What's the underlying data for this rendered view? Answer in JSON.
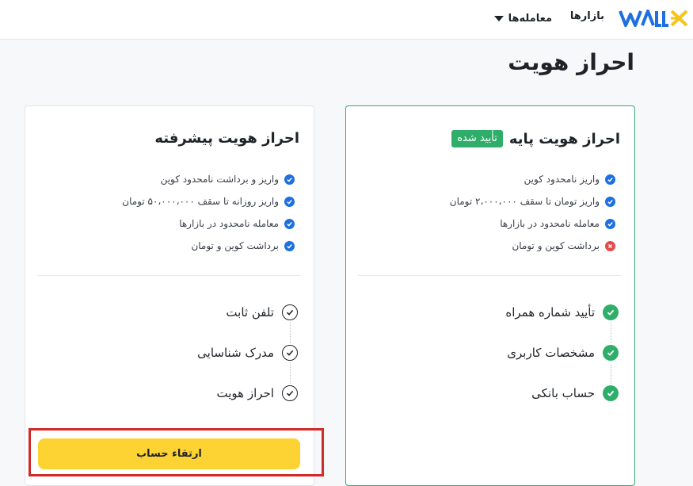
{
  "header": {
    "brand": "WALLEX",
    "nav": {
      "markets": "بازارها",
      "trade": "معامله‌ها"
    }
  },
  "page": {
    "title": "احراز هویت"
  },
  "cards": {
    "basic": {
      "title": "احراز هویت پایه",
      "badge": "تأیید شده",
      "features": [
        "واریز نامحدود کوین",
        "واریز تومان تا سقف ۲،۰۰۰،۰۰۰ تومان",
        "معامله نامحدود در بازارها",
        "برداشت کوین و تومان"
      ],
      "steps": [
        "تأیید شماره همراه",
        "مشخصات کاربری",
        "حساب بانکی"
      ]
    },
    "advanced": {
      "title": "احراز هویت پیشرفته",
      "features": [
        "واریز و برداشت نامحدود کوین",
        "واریز روزانه تا سقف ۵۰،۰۰۰،۰۰۰ تومان",
        "معامله نامحدود در بازارها",
        "برداشت کوین و تومان"
      ],
      "steps": [
        "تلفن ثابت",
        "مدرک شناسایی",
        "احراز هویت"
      ],
      "upgrade_button": "ارتقاء حساب"
    }
  },
  "colors": {
    "brand_blue": "#1e6fe0",
    "brand_yellow": "#f5c518",
    "success_green": "#2fae6a",
    "error_red": "#e34b4b",
    "highlight_red": "#d12a2a",
    "button_yellow": "#fdd233"
  },
  "icons": {
    "feature_ok": "check-circle-icon",
    "feature_no": "cross-circle-icon",
    "step_done": "check-circle-filled-icon",
    "step_todo": "check-circle-outline-icon",
    "trade_dropdown": "caret-down-icon"
  }
}
